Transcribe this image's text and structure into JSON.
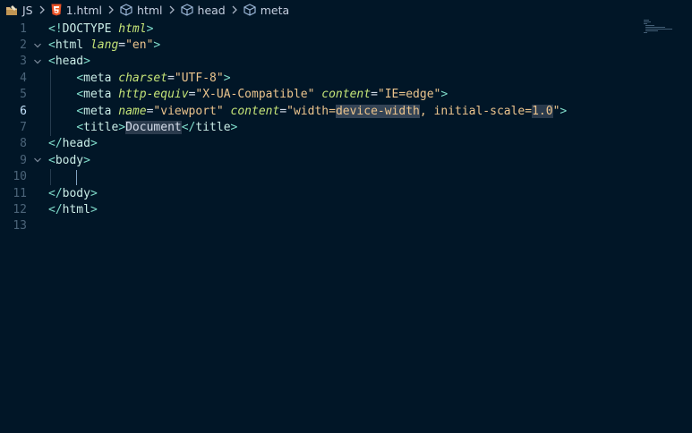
{
  "breadcrumb": [
    {
      "label": "JS",
      "icon": "folder-icon"
    },
    {
      "label": "1.html",
      "icon": "html5-icon"
    },
    {
      "label": "html",
      "icon": "cube-icon"
    },
    {
      "label": "head",
      "icon": "cube-icon"
    },
    {
      "label": "meta",
      "icon": "cube-icon"
    }
  ],
  "active_line": 6,
  "lines": [
    {
      "num": "1",
      "parts": [
        [
          "punct",
          "<!"
        ],
        [
          "tag",
          "DOCTYPE "
        ],
        [
          "attr",
          "html"
        ],
        [
          "punct",
          ">"
        ]
      ]
    },
    {
      "num": "2",
      "fold": true,
      "parts": [
        [
          "punct",
          "<"
        ],
        [
          "tag",
          "html "
        ],
        [
          "attr",
          "lang"
        ],
        [
          "eq",
          "="
        ],
        [
          "str",
          "\"en\""
        ],
        [
          "punct",
          ">"
        ]
      ]
    },
    {
      "num": "3",
      "fold": true,
      "parts": [
        [
          "punct",
          "<"
        ],
        [
          "tag",
          "head"
        ],
        [
          "punct",
          ">"
        ]
      ]
    },
    {
      "num": "4",
      "parts": [
        [
          "text",
          "    "
        ],
        [
          "punct",
          "<"
        ],
        [
          "tag",
          "meta "
        ],
        [
          "attr",
          "charset"
        ],
        [
          "eq",
          "="
        ],
        [
          "str",
          "\"UTF-8\""
        ],
        [
          "punct",
          ">"
        ]
      ]
    },
    {
      "num": "5",
      "parts": [
        [
          "text",
          "    "
        ],
        [
          "punct",
          "<"
        ],
        [
          "tag",
          "meta "
        ],
        [
          "attr",
          "http-equiv"
        ],
        [
          "eq",
          "="
        ],
        [
          "str",
          "\"X-UA-Compatible\" "
        ],
        [
          "attr",
          "content"
        ],
        [
          "eq",
          "="
        ],
        [
          "str",
          "\"IE=edge\""
        ],
        [
          "punct",
          ">"
        ]
      ]
    },
    {
      "num": "6",
      "parts": [
        [
          "text",
          "    "
        ],
        [
          "punct",
          "<"
        ],
        [
          "tag",
          "meta "
        ],
        [
          "attr",
          "name"
        ],
        [
          "eq",
          "="
        ],
        [
          "str",
          "\"viewport\" "
        ],
        [
          "attr",
          "content"
        ],
        [
          "eq",
          "="
        ],
        [
          "str",
          "\"width="
        ],
        [
          "strhl",
          "device-width"
        ],
        [
          "str",
          ", initial-scale="
        ],
        [
          "strhl2",
          "1.0"
        ],
        [
          "str",
          "\""
        ],
        [
          "punct",
          ">"
        ]
      ]
    },
    {
      "num": "7",
      "parts": [
        [
          "text",
          "    "
        ],
        [
          "punct",
          "<"
        ],
        [
          "tag",
          "title"
        ],
        [
          "punct",
          ">"
        ],
        [
          "texthl",
          "Document"
        ],
        [
          "punct",
          "</"
        ],
        [
          "tag",
          "title"
        ],
        [
          "punct",
          ">"
        ]
      ]
    },
    {
      "num": "8",
      "parts": [
        [
          "punct",
          "</"
        ],
        [
          "tag",
          "head"
        ],
        [
          "punct",
          ">"
        ]
      ]
    },
    {
      "num": "9",
      "fold": true,
      "parts": [
        [
          "punct",
          "<"
        ],
        [
          "tag",
          "body"
        ],
        [
          "punct",
          ">"
        ]
      ]
    },
    {
      "num": "10",
      "parts": []
    },
    {
      "num": "11",
      "parts": [
        [
          "punct",
          "</"
        ],
        [
          "tag",
          "body"
        ],
        [
          "punct",
          ">"
        ]
      ]
    },
    {
      "num": "12",
      "parts": [
        [
          "punct",
          "</"
        ],
        [
          "tag",
          "html"
        ],
        [
          "punct",
          ">"
        ]
      ]
    },
    {
      "num": "13",
      "parts": []
    }
  ],
  "colors": {
    "background": "#011627",
    "tag_punct": "#7fdbca",
    "attribute": "#c5e478",
    "string": "#ecc48d",
    "line_number": "#4b6479",
    "active_line_number": "#c5e4fd",
    "html5_orange": "#e44d26"
  }
}
